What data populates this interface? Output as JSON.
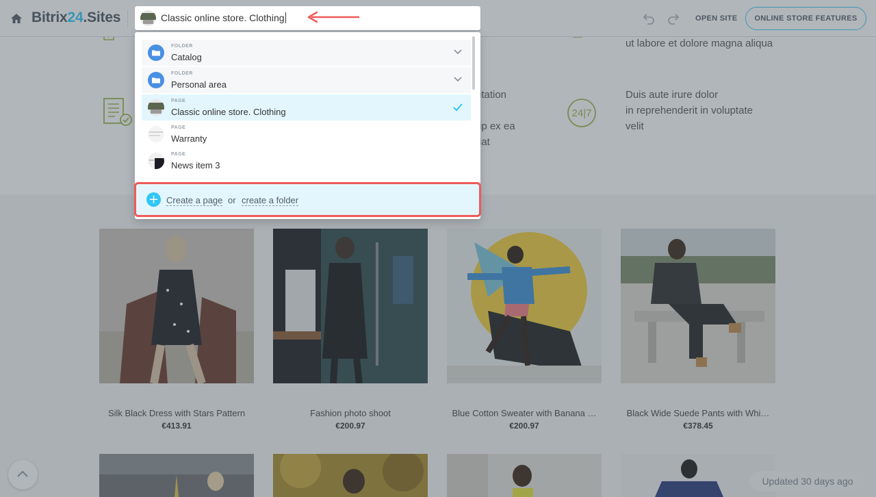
{
  "header": {
    "logo_part1": "Bitrix",
    "logo_part2": "24",
    "logo_part3": ".Sites",
    "open_site": "OPEN SITE",
    "features_button": "ONLINE STORE FEATURES",
    "accent_color": "#2fc6f6"
  },
  "search": {
    "value": "Classic online store. Clothing"
  },
  "dropdown": {
    "items": [
      {
        "kind": "FOLDER",
        "label": "Catalog",
        "type": "folder"
      },
      {
        "kind": "FOLDER",
        "label": "Personal area",
        "type": "folder"
      },
      {
        "kind": "PAGE",
        "label": "Classic online store. Clothing",
        "type": "page",
        "selected": true
      },
      {
        "kind": "PAGE",
        "label": "Warranty",
        "type": "page"
      },
      {
        "kind": "PAGE",
        "label": "News item 3",
        "type": "page"
      }
    ],
    "create_page": "Create a page",
    "or": "or",
    "create_folder": "create a folder"
  },
  "features": {
    "text1": "ut labore et dolore magna aliqua",
    "text2_lines": [
      "itation",
      "ip ex ea",
      "iat"
    ],
    "text3_lines": [
      "Duis aute irure dolor",
      "in reprehenderit in voluptate",
      "velit"
    ],
    "badge_24_7": "24|7"
  },
  "products": [
    {
      "name": "Silk Black Dress with Stars Pattern",
      "price": "€413.91"
    },
    {
      "name": "Fashion photo shoot",
      "price": "€200.97"
    },
    {
      "name": "Blue Cotton Sweater with Banana …",
      "price": "€200.97"
    },
    {
      "name": "Black Wide Suede Pants with Whi…",
      "price": "€378.45"
    }
  ],
  "footer": {
    "updated": "Updated 30 days ago"
  }
}
